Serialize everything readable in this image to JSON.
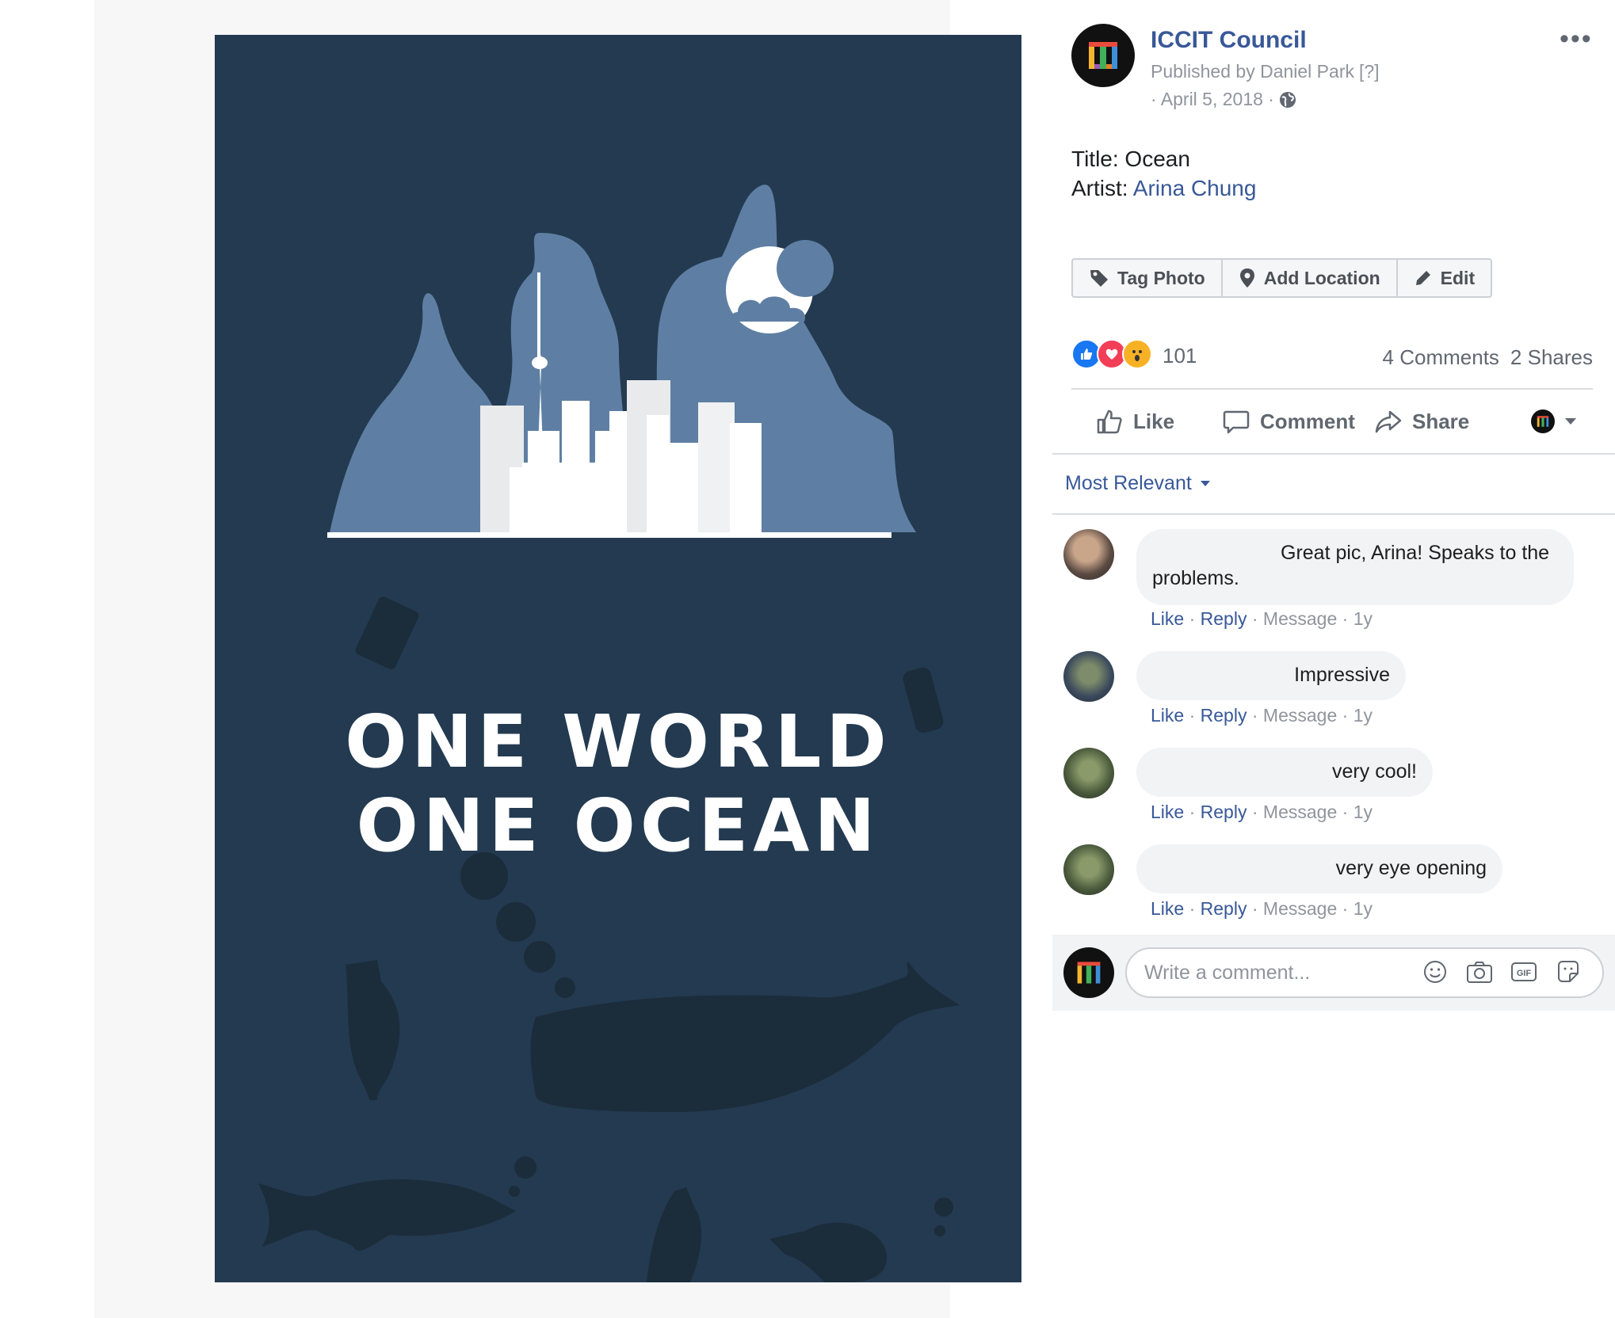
{
  "post": {
    "page_name": "ICCIT Council",
    "published_by": "Published by Daniel Park",
    "published_help": "[?]",
    "date": "· April 5, 2018 ·",
    "more_label": "•••",
    "caption_title": "Title: Ocean",
    "caption_artist_prefix": "Artist: ",
    "caption_artist_name": "Arina Chung"
  },
  "poster": {
    "line1": "ONE WORLD",
    "line2": "ONE OCEAN"
  },
  "photo_actions": {
    "tag_photo": "Tag Photo",
    "add_location": "Add Location",
    "edit": "Edit"
  },
  "engagement": {
    "reaction_count": "101",
    "comments": "4 Comments",
    "shares": "2 Shares"
  },
  "action_bar": {
    "like": "Like",
    "comment": "Comment",
    "share": "Share"
  },
  "comment_sort": "Most Relevant",
  "comments": [
    {
      "text": "Great pic, Arina! Speaks to the problems.",
      "like": "Like",
      "reply": "Reply",
      "message": "Message",
      "age": "1y"
    },
    {
      "text": "Impressive",
      "like": "Like",
      "reply": "Reply",
      "message": "Message",
      "age": "1y"
    },
    {
      "text": "very cool!",
      "like": "Like",
      "reply": "Reply",
      "message": "Message",
      "age": "1y"
    },
    {
      "text": "very eye opening",
      "like": "Like",
      "reply": "Reply",
      "message": "Message",
      "age": "1y"
    }
  ],
  "composer": {
    "placeholder": "Write a comment..."
  },
  "colors": {
    "poster_bg": "#233a50",
    "link_blue": "#385898",
    "muted_gray": "#90949c"
  }
}
